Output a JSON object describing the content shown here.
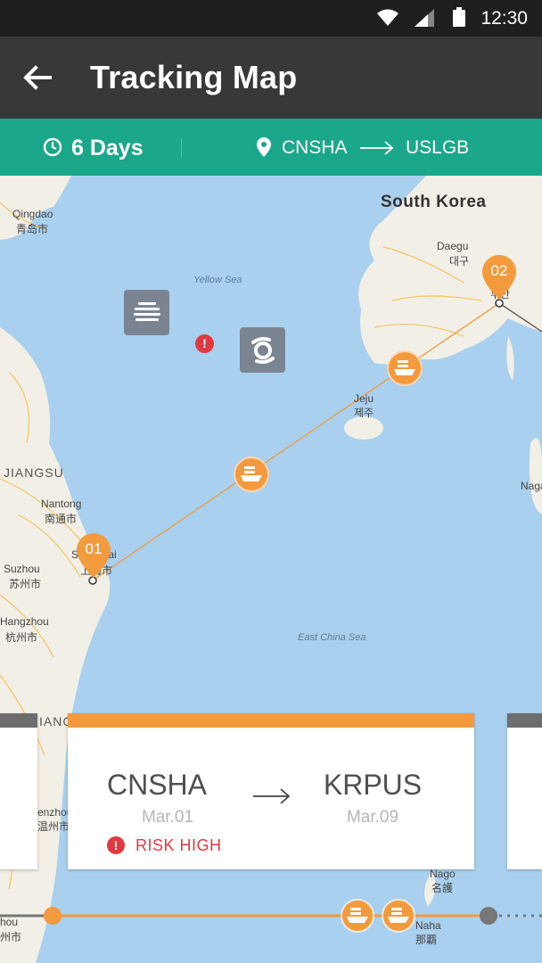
{
  "status_bar": {
    "time": "12:30"
  },
  "app_bar": {
    "title": "Tracking Map"
  },
  "route_bar": {
    "duration": "6 Days",
    "origin": "CNSHA",
    "destination": "USLGB"
  },
  "map": {
    "labels": {
      "qingdao": "Qingdao",
      "qingdao_cn": "青岛市",
      "yellow_sea": "Yellow Sea",
      "south_korea": "South Korea",
      "daegu": "Daegu",
      "daegu_kr": "대구",
      "jeju": "Jeju",
      "jeju_kr": "제주",
      "jiangsu": "JIANGSU",
      "nantong": "Nantong",
      "nantong_cn": "南通市",
      "shanghai": "Shanghai",
      "shanghai_cn": "上海市",
      "suzhou": "Suzhou",
      "suzhou_cn": "苏州市",
      "hangzhou": "Hangzhou",
      "hangzhou_cn": "杭州市",
      "east_china_sea": "East China Sea",
      "busan_kr": "부산",
      "naga": "Nago",
      "naga_jp": "名護",
      "naha": "Naha",
      "naha_jp": "那覇",
      "nagasaki": "Naga",
      "zhejiang": "IANG",
      "wenzhou": "enzhou",
      "wenzhou_cn": "温州市",
      "fuzhou": "hou",
      "fuzhou_cn": "州市"
    },
    "port_pins": [
      {
        "label": "01",
        "port": "CNSHA"
      },
      {
        "label": "02",
        "port": "KRPUS"
      }
    ],
    "icons": [
      "fog-icon",
      "risk-alert-icon",
      "cyclone-icon",
      "ship-icon",
      "ship-icon"
    ]
  },
  "cards": {
    "current": {
      "from_port": "CNSHA",
      "from_date": "Mar.01",
      "to_port": "KRPUS",
      "to_date": "Mar.09",
      "risk_label": "RISK HIGH"
    }
  },
  "colors": {
    "status_bar": "#1f1f1f",
    "app_bar": "#383838",
    "route_bar": "#1ba78a",
    "accent_orange": "#f39a3d",
    "risk_red": "#e0393e",
    "sea": "#a9d0ee",
    "land": "#f2efe6"
  }
}
